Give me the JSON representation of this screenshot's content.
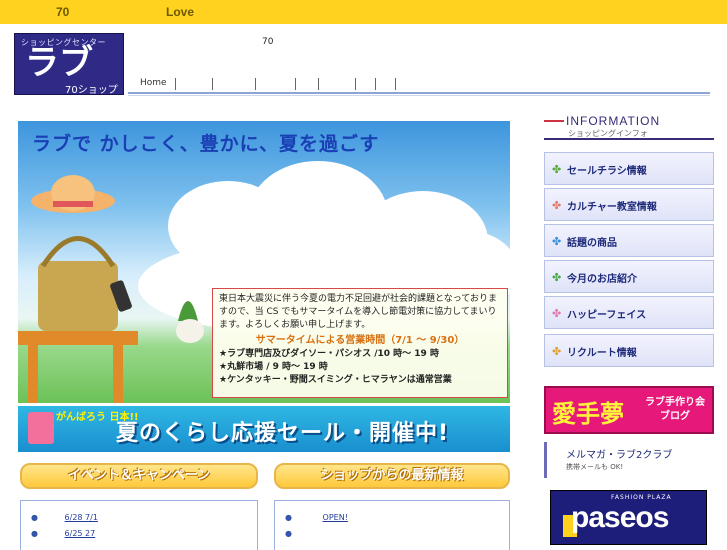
{
  "topbar": {
    "num": "70",
    "love": "Love"
  },
  "logo": {
    "small": "ショッピングセンター",
    "big": "ラブ",
    "sub": "70ショップ"
  },
  "header": {
    "num": "70",
    "nav_home": "Home"
  },
  "hero": {
    "title": "ラブで かしこく、豊かに、夏を過ごす",
    "notice_text": "東日本大震災に伴う今夏の電力不足回避が社会的課題となっておりますので、当 CS でもサマータイムを導入し節電対策に協力してまいります。よろしくお願い申し上げます。",
    "notice_sub": "サマータイムによる営業時間（7/1 ～ 9/30）",
    "items": [
      "★ラブ専門店及びダイソー・パシオス /10 時～ 19 時",
      "★丸鮮市場 / 9 時～ 19 時",
      "★ケンタッキー・野間スイミング・ヒマラヤンは通常営業"
    ]
  },
  "banner": {
    "ganba": "がんばろう 日本!!",
    "main": "夏のくらし応援セール・開催中!"
  },
  "sections": {
    "event": "イベント＆キャンペーン",
    "shop": "ショップからの最新情報"
  },
  "event_list": [
    {
      "date": "6/28 7/1"
    },
    {
      "date": "6/25 27"
    }
  ],
  "shop_list": [
    {
      "text": "OPEN!"
    },
    {
      "text": ""
    }
  ],
  "sidebar": {
    "info_title": "INFORMATION",
    "info_sub": "ショッピングインフォ",
    "items": [
      {
        "label": "セールチラシ情報",
        "icon": "clover-icon",
        "color": "#5aa83a"
      },
      {
        "label": "カルチャー教室情報",
        "icon": "clover-icon",
        "color": "#e07a6a"
      },
      {
        "label": "話題の商品",
        "icon": "clover-icon",
        "color": "#3a8fd6"
      },
      {
        "label": "今月のお店紹介",
        "icon": "clover-icon",
        "color": "#4aa84a"
      },
      {
        "label": "ハッピーフェイス",
        "icon": "clover-icon",
        "color": "#e07ab0"
      },
      {
        "label": "リクルート情報",
        "icon": "clover-icon",
        "color": "#e0a030"
      }
    ],
    "aide_kanji": "愛手夢",
    "aide_text": "ラブ手作り会 ブログ",
    "mm_title": "メルマガ・ラブ2クラブ",
    "mm_sub": "携帯メールも OK!",
    "paseos_top": "FASHION PLAZA",
    "paseos_word": "paseos"
  }
}
